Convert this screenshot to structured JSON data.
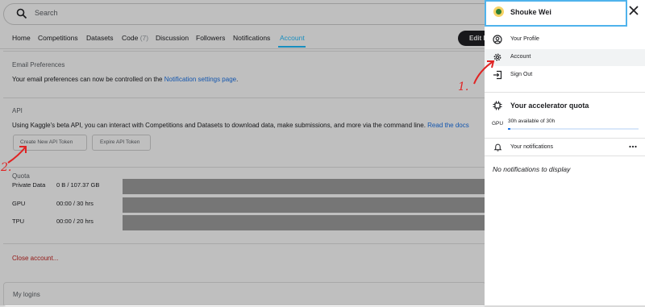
{
  "search": {
    "placeholder": "Search"
  },
  "tabs": [
    {
      "label": "Home"
    },
    {
      "label": "Competitions"
    },
    {
      "label": "Datasets"
    },
    {
      "label": "Code",
      "count": "(7)"
    },
    {
      "label": "Discussion"
    },
    {
      "label": "Followers"
    },
    {
      "label": "Notifications"
    },
    {
      "label": "Account",
      "active": true
    }
  ],
  "edit_button": "Edit P",
  "email_prefs": {
    "title": "Email Preferences",
    "text": "Your email preferences can now be controlled on the ",
    "link": "Notification settings page",
    "suffix": "."
  },
  "api": {
    "title": "API",
    "text": "Using Kaggle's beta API, you can interact with Competitions and Datasets to download data, make submissions, and more via the command line. ",
    "link": "Read the docs",
    "create_button": "Create New API Token",
    "expire_button": "Expire API Token"
  },
  "quota": {
    "title": "Quota",
    "rows": [
      {
        "label": "Private Data",
        "value": "0 B / 107.37 GB"
      },
      {
        "label": "GPU",
        "value": "00:00 / 30 hrs"
      },
      {
        "label": "TPU",
        "value": "00:00 / 20 hrs"
      }
    ]
  },
  "close_account": "Close account...",
  "my_logins": "My logins",
  "panel": {
    "user_name": "Shouke Wei",
    "menu": [
      {
        "label": "Your Profile",
        "icon": "profile-icon"
      },
      {
        "label": "Account",
        "icon": "gear-icon"
      },
      {
        "label": "Sign Out",
        "icon": "sign-out-icon"
      }
    ],
    "accelerator": {
      "title": "Your accelerator quota",
      "gpu_label": "GPU",
      "gpu_text": "30h available of 30h",
      "gpu_fraction": 0.02
    },
    "notifications_label": "Your notifications",
    "no_notifications": "No notifications to display"
  },
  "annotations": {
    "step1": "1.",
    "step2": "2."
  },
  "colors": {
    "accent": "#20beff",
    "link": "#1a73e8",
    "danger": "#c5221f",
    "annotation": "#e02424",
    "focus": "#4fb3ec"
  }
}
